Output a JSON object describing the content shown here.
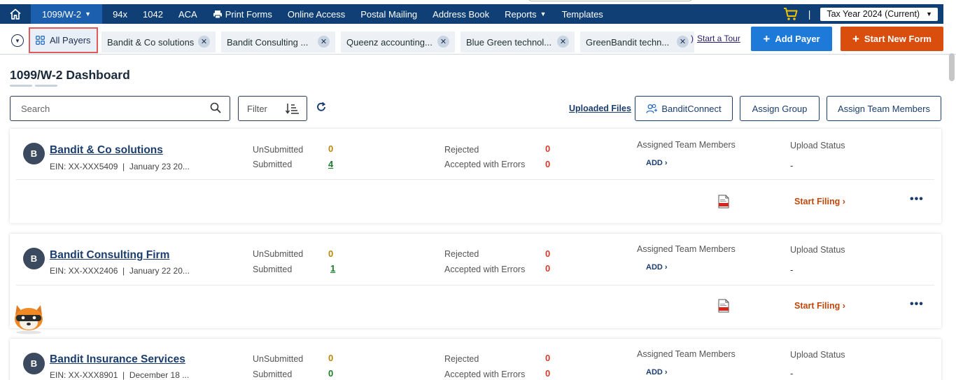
{
  "nav": {
    "home_icon": "home-icon",
    "active": "1099/W-2",
    "items": [
      "94x",
      "1042",
      "ACA",
      "Print Forms",
      "Online Access",
      "Postal Mailing",
      "Address Book",
      "Reports",
      "Templates"
    ],
    "cart_icon": "cart-icon",
    "separator": "|",
    "tax_year": "Tax Year 2024 (Current)"
  },
  "tabs": {
    "all_payers": "All Payers",
    "payer_tabs": [
      "Bandit & Co solutions",
      "Bandit Consulting ...",
      "Queenz accounting...",
      "Blue Green technol...",
      "GreenBandit techn..."
    ],
    "tour_prefix": ")",
    "tour": "Start a Tour",
    "add_payer": "Add Payer",
    "start_new_form": "Start New Form"
  },
  "dashboard": {
    "title": "1099/W-2 Dashboard",
    "search_placeholder": "Search",
    "filter": "Filter",
    "uploaded_files": "Uploaded Files",
    "bandit_connect": "BanditConnect",
    "assign_group": "Assign Group",
    "assign_team_members": "Assign Team Members"
  },
  "labels": {
    "unsubmitted": "UnSubmitted",
    "submitted": "Submitted",
    "rejected": "Rejected",
    "accepted_with_errors": "Accepted with Errors",
    "assigned_team_members": "Assigned Team Members",
    "add": "ADD",
    "upload_status": "Upload Status",
    "start_filing": "Start Filing",
    "more": "•••"
  },
  "payers": [
    {
      "initial": "B",
      "name": "Bandit & Co solutions",
      "ein": "EIN: XX-XXX5409",
      "date": "January 23 20...",
      "unsubmitted": "0",
      "submitted": "4",
      "rejected": "0",
      "accepted_with_errors": "0",
      "upload_status": "-"
    },
    {
      "initial": "B",
      "name": "Bandit Consulting Firm",
      "ein": "EIN: XX-XXX2406",
      "date": "January 22 20...",
      "unsubmitted": "0",
      "submitted": "1",
      "rejected": "0",
      "accepted_with_errors": "0",
      "upload_status": "-"
    },
    {
      "initial": "B",
      "name": "Bandit Insurance Services",
      "ein": "EIN: XX-XXX8901",
      "date": "December 18 ...",
      "unsubmitted": "0",
      "submitted": "0",
      "rejected": "0",
      "accepted_with_errors": "0",
      "upload_status": "-"
    }
  ],
  "colors": {
    "nav_bg": "#0f3f74",
    "nav_active": "#1c5fae",
    "add_payer": "#1d7ad8",
    "start_new_form": "#d94e0d",
    "highlight_box": "#e05a5a"
  }
}
